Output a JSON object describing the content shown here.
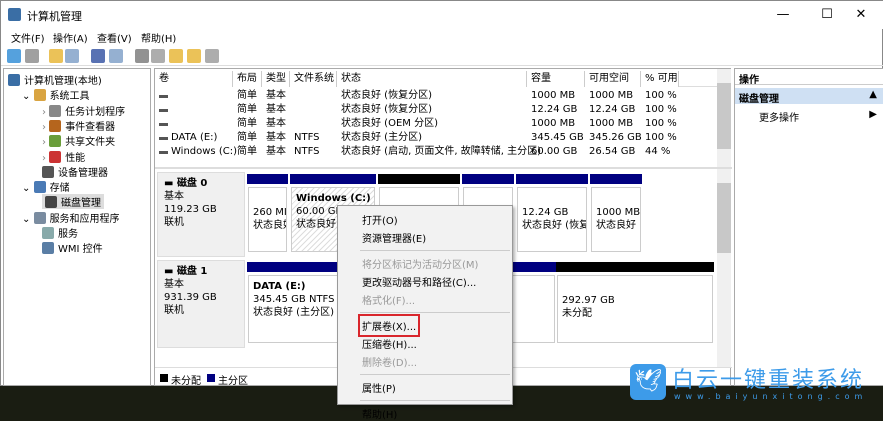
{
  "window": {
    "title": "计算机管理",
    "minimize": "—",
    "maximize": "☐",
    "close": "✕"
  },
  "menu": [
    "文件(F)",
    "操作(A)",
    "查看(V)",
    "帮助(H)"
  ],
  "toolbar": [
    "back-icon",
    "forward-icon",
    "up-folder-icon",
    "show-hide-tree-icon",
    "help-icon",
    "console-icon",
    "connect-icon",
    "check-icon",
    "folder-up-icon",
    "folder-search-icon",
    "properties-icon"
  ],
  "tree": [
    {
      "label": "计算机管理(本地)",
      "level": 0,
      "icon": "computer-icon"
    },
    {
      "label": "系统工具",
      "level": 1,
      "icon": "tools-icon",
      "expanded": true
    },
    {
      "label": "任务计划程序",
      "level": 2,
      "icon": "clock-icon"
    },
    {
      "label": "事件查看器",
      "level": 2,
      "icon": "event-viewer-icon"
    },
    {
      "label": "共享文件夹",
      "level": 2,
      "icon": "shared-folder-icon"
    },
    {
      "label": "性能",
      "level": 2,
      "icon": "performance-icon"
    },
    {
      "label": "设备管理器",
      "level": 2,
      "icon": "device-manager-icon"
    },
    {
      "label": "存储",
      "level": 1,
      "icon": "storage-icon",
      "expanded": true
    },
    {
      "label": "磁盘管理",
      "level": 2,
      "icon": "disk-icon",
      "selected": true
    },
    {
      "label": "服务和应用程序",
      "level": 1,
      "icon": "services-apps-icon",
      "expanded": true
    },
    {
      "label": "服务",
      "level": 2,
      "icon": "services-icon"
    },
    {
      "label": "WMI 控件",
      "level": 2,
      "icon": "wmi-icon"
    }
  ],
  "table": {
    "columns": [
      "卷",
      "布局",
      "类型",
      "文件系统",
      "状态",
      "容量",
      "可用空间",
      "% 可用"
    ],
    "rows": [
      [
        "",
        "简单",
        "基本",
        "",
        "状态良好 (恢复分区)",
        "1000 MB",
        "1000 MB",
        "100 %"
      ],
      [
        "",
        "简单",
        "基本",
        "",
        "状态良好 (恢复分区)",
        "12.24 GB",
        "12.24 GB",
        "100 %"
      ],
      [
        "",
        "简单",
        "基本",
        "",
        "状态良好 (OEM 分区)",
        "1000 MB",
        "1000 MB",
        "100 %"
      ],
      [
        "DATA (E:)",
        "简单",
        "基本",
        "NTFS",
        "状态良好 (主分区)",
        "345.45 GB",
        "345.26 GB",
        "100 %"
      ],
      [
        "Windows (C:)",
        "简单",
        "基本",
        "NTFS",
        "状态良好 (启动, 页面文件, 故障转储, 主分区)",
        "60.00 GB",
        "26.54 GB",
        "44 %"
      ]
    ]
  },
  "disks": [
    {
      "name": "磁盘 0",
      "type": "基本",
      "size": "119.23 GB",
      "status": "联机",
      "partitions": [
        {
          "name": "",
          "size": "260 MI",
          "status": "状态良好",
          "kind": "primary"
        },
        {
          "name": "Windows (C:)",
          "size": "60.00 GB",
          "status": "状态良好",
          "kind": "primary",
          "selected": true
        },
        {
          "name": "",
          "size": "",
          "status": "",
          "kind": "unallocated"
        },
        {
          "name": "",
          "size": "",
          "status": "",
          "kind": "primary"
        },
        {
          "name": "",
          "size": "12.24 GB",
          "status": "状态良好 (恢复",
          "kind": "primary"
        },
        {
          "name": "",
          "size": "1000 MB",
          "status": "状态良好 (",
          "kind": "primary"
        }
      ]
    },
    {
      "name": "磁盘 1",
      "type": "基本",
      "size": "931.39 GB",
      "status": "联机",
      "partitions": [
        {
          "name": "DATA (E:)",
          "size": "345.45 GB NTFS",
          "status": "状态良好 (主分区)",
          "kind": "primary"
        },
        {
          "name": "",
          "size": "292.97 GB",
          "status": "未分配",
          "kind": "unallocated"
        }
      ]
    }
  ],
  "legend": [
    {
      "label": "未分配",
      "color": "#000000"
    },
    {
      "label": "主分区",
      "color": "#000080"
    }
  ],
  "context_menu": [
    {
      "label": "打开(O)",
      "enabled": true
    },
    {
      "label": "资源管理器(E)",
      "enabled": true
    },
    {
      "sep": true
    },
    {
      "label": "将分区标记为活动分区(M)",
      "enabled": false
    },
    {
      "label": "更改驱动器号和路径(C)...",
      "enabled": true
    },
    {
      "label": "格式化(F)...",
      "enabled": false
    },
    {
      "sep": true
    },
    {
      "label": "扩展卷(X)...",
      "enabled": true,
      "highlighted": true
    },
    {
      "label": "压缩卷(H)...",
      "enabled": true
    },
    {
      "label": "删除卷(D)...",
      "enabled": false
    },
    {
      "sep": true
    },
    {
      "label": "属性(P)",
      "enabled": true
    },
    {
      "sep": true
    },
    {
      "label": "帮助(H)",
      "enabled": true
    }
  ],
  "actions": {
    "header": "操作",
    "section": "磁盘管理",
    "more": "更多操作"
  },
  "watermark": {
    "text": "白云一键重装系统",
    "url": "www.baiyunxitong.com"
  },
  "colors": {
    "primary": "#000080",
    "unallocated": "#000000",
    "highlight_box": "#d9262c",
    "action_header": "#cfe0f3"
  }
}
